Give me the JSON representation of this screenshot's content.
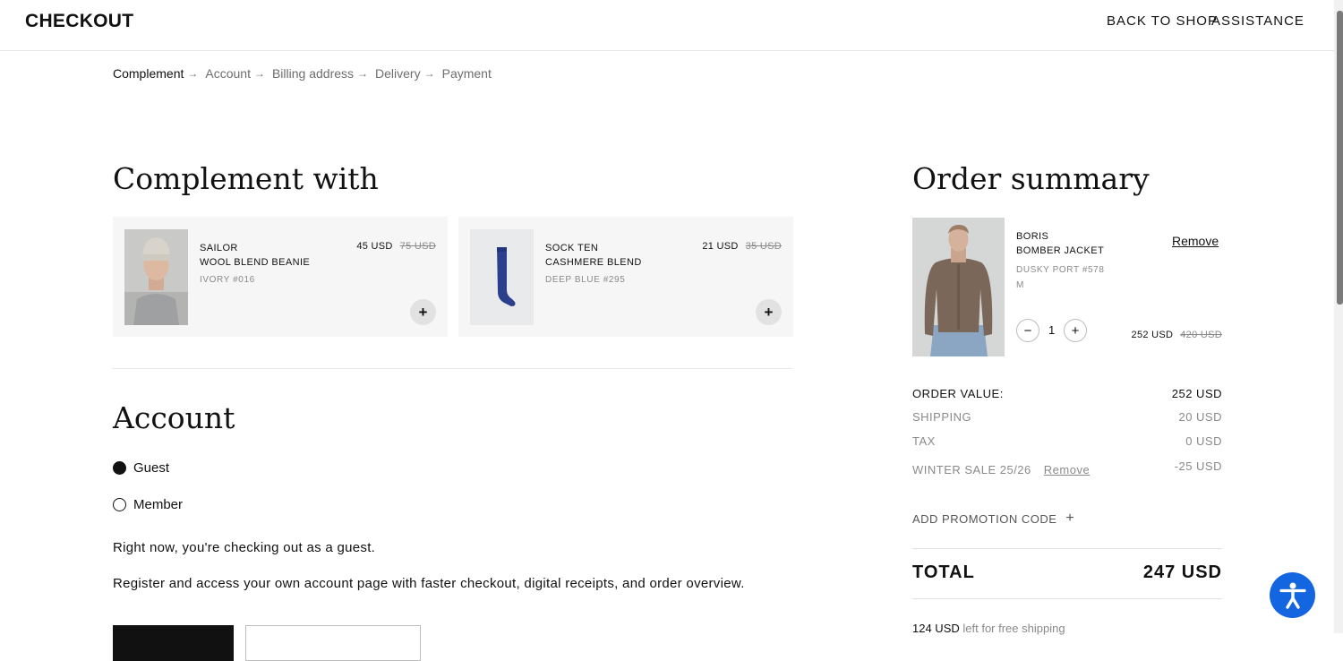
{
  "header": {
    "brand": "CHECKOUT",
    "nav": [
      "BACK TO SHOP",
      "ASSISTANCE"
    ]
  },
  "breadcrumb": [
    "Complement",
    "Account",
    "Billing address",
    "Delivery",
    "Payment"
  ],
  "breadcrumb_arrow": "→",
  "complement": {
    "title": "Complement with",
    "products": [
      {
        "name_line1": "SAILOR",
        "name_line2": "WOOL BLEND BEANIE",
        "variant": "IVORY #016",
        "price": "45 USD",
        "old_price": "75 USD",
        "add": "+"
      },
      {
        "name_line1": "SOCK TEN",
        "name_line2": "CASHMERE BLEND",
        "variant": "DEEP BLUE #295",
        "price": "21 USD",
        "old_price": "35 USD",
        "add": "+"
      }
    ]
  },
  "account": {
    "title": "Account",
    "options": [
      {
        "label": "Guest",
        "selected": true
      },
      {
        "label": "Member",
        "selected": false
      }
    ],
    "guest_note": "Right now, you're checking out as a guest.",
    "register_note": "Register and access your own account page with faster checkout, digital receipts, and order overview."
  },
  "summary": {
    "title": "Order summary",
    "item": {
      "name_line1": "BORIS",
      "name_line2": "BOMBER JACKET",
      "variant": "DUSKY PORT #578",
      "size": "M",
      "remove": "Remove",
      "minus": "−",
      "qty": "1",
      "plus": "+",
      "price": "252 USD",
      "old_price": "420 USD"
    },
    "order_value_label": "ORDER VALUE:",
    "order_value": "252 USD",
    "shipping_label": "SHIPPING",
    "shipping": "20 USD",
    "tax_label": "TAX",
    "tax": "0 USD",
    "promo_label": "WINTER SALE 25/26",
    "promo_remove": "Remove",
    "promo_value": "-25 USD",
    "add_promo": "ADD PROMOTION CODE",
    "add_promo_icon": "+",
    "total_label": "TOTAL",
    "total": "247 USD",
    "free_shipping_amount": "124 USD",
    "free_shipping_text": "left for free shipping"
  },
  "colors": {
    "accent_accessibility": "#1466e0",
    "card_bg": "#f6f6f6",
    "muted_text": "#8a8a8a"
  },
  "icons": {
    "add_product": "plus-icon",
    "accessibility": "accessibility-person-icon",
    "arrow": "arrow-right-icon"
  }
}
